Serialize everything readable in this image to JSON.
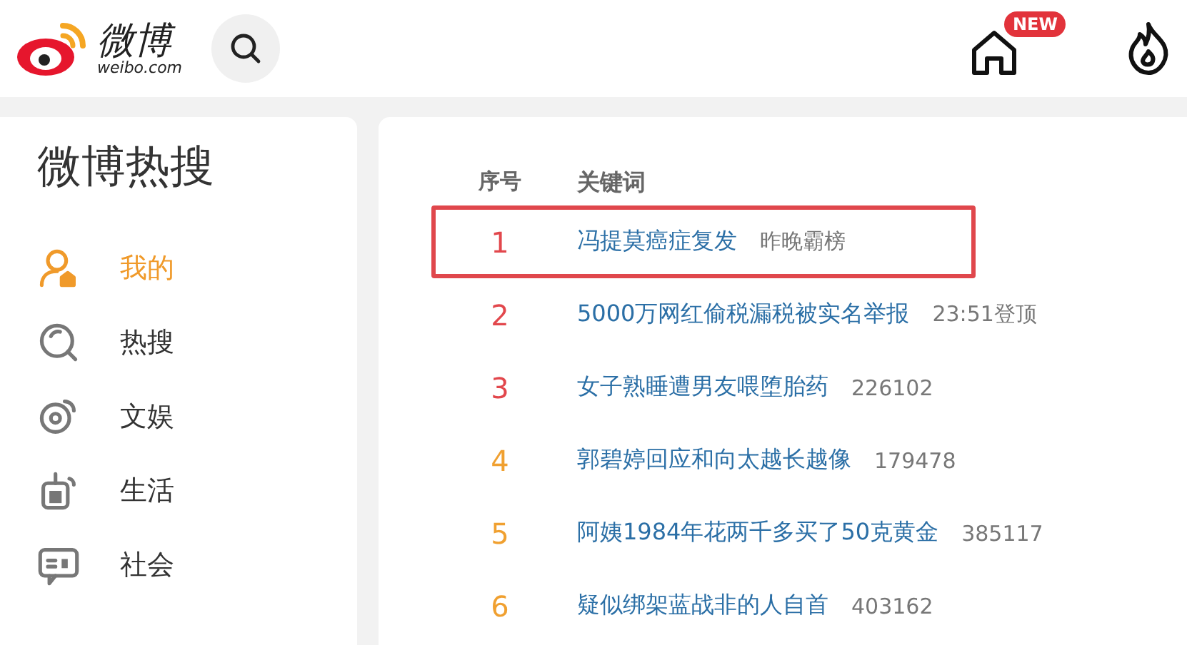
{
  "header": {
    "logo_text": "微博",
    "logo_subtext": "weibo.com",
    "home_badge": "NEW"
  },
  "sidebar": {
    "title": "微博热搜",
    "items": [
      {
        "label": "我的",
        "selected": true
      },
      {
        "label": "热搜",
        "selected": false
      },
      {
        "label": "文娱",
        "selected": false
      },
      {
        "label": "生活",
        "selected": false
      },
      {
        "label": "社会",
        "selected": false
      }
    ]
  },
  "hot_list": {
    "columns": [
      "序号",
      "关键词"
    ],
    "rows": [
      {
        "rank": "1",
        "color": "#e2474c",
        "keyword": "冯提莫癌症复发",
        "status": "昨晚霸榜",
        "highlighted": true
      },
      {
        "rank": "2",
        "color": "#e2474c",
        "keyword": "5000万网红偷税漏税被实名举报",
        "status": "23:51登顶",
        "highlighted": false
      },
      {
        "rank": "3",
        "color": "#e2474c",
        "keyword": "女子熟睡遭男友喂堕胎药",
        "heat": "226102",
        "highlighted": false
      },
      {
        "rank": "4",
        "color": "#f0a030",
        "keyword": "郭碧婷回应和向太越长越像",
        "heat": "179478",
        "highlighted": false
      },
      {
        "rank": "5",
        "color": "#f0a030",
        "keyword": "阿姨1984年花两千多买了50克黄金",
        "heat": "385117",
        "highlighted": false
      },
      {
        "rank": "6",
        "color": "#f0a030",
        "keyword": "疑似绑架蓝战非的人自首",
        "heat": "403162",
        "highlighted": false
      }
    ]
  }
}
